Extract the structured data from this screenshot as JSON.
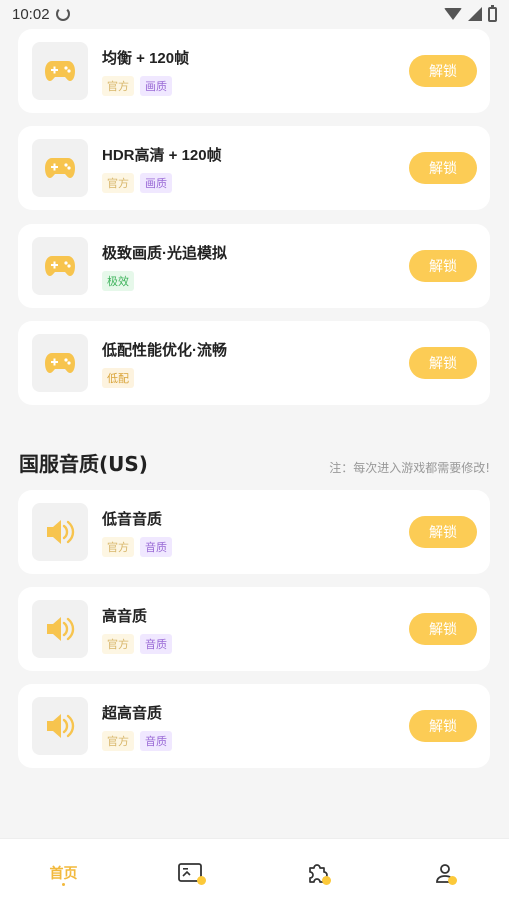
{
  "status_bar": {
    "time": "10:02"
  },
  "graphics_items": [
    {
      "title": "均衡 + 120帧",
      "tags": [
        {
          "text": "官方",
          "kind": "official"
        },
        {
          "text": "画质",
          "kind": "quality"
        }
      ],
      "button": "解锁",
      "icon": "gamepad-icon"
    },
    {
      "title": "HDR高清 + 120帧",
      "tags": [
        {
          "text": "官方",
          "kind": "official"
        },
        {
          "text": "画质",
          "kind": "quality"
        }
      ],
      "button": "解锁",
      "icon": "gamepad-icon"
    },
    {
      "title": "极致画质·光追模拟",
      "tags": [
        {
          "text": "极效",
          "kind": "effect"
        }
      ],
      "button": "解锁",
      "icon": "gamepad-icon"
    },
    {
      "title": "低配性能优化·流畅",
      "tags": [
        {
          "text": "低配",
          "kind": "low"
        }
      ],
      "button": "解锁",
      "icon": "gamepad-icon"
    }
  ],
  "audio_section": {
    "title": "国服音质(US)",
    "note": "注：每次进入游戏都需要修改!"
  },
  "audio_items": [
    {
      "title": "低音音质",
      "tags": [
        {
          "text": "官方",
          "kind": "official"
        },
        {
          "text": "音质",
          "kind": "quality"
        }
      ],
      "button": "解锁",
      "icon": "speaker-icon"
    },
    {
      "title": "高音质",
      "tags": [
        {
          "text": "官方",
          "kind": "official"
        },
        {
          "text": "音质",
          "kind": "quality"
        }
      ],
      "button": "解锁",
      "icon": "speaker-icon"
    },
    {
      "title": "超高音质",
      "tags": [
        {
          "text": "官方",
          "kind": "official"
        },
        {
          "text": "音质",
          "kind": "quality"
        }
      ],
      "button": "解锁",
      "icon": "speaker-icon"
    }
  ],
  "bottom_nav": {
    "home_label": "首页",
    "items": [
      "home",
      "gallery-icon",
      "puzzle-icon",
      "profile-icon"
    ]
  },
  "colors": {
    "accent": "#fccc55",
    "icon": "#f7c44e",
    "background": "#f5f5f5"
  }
}
